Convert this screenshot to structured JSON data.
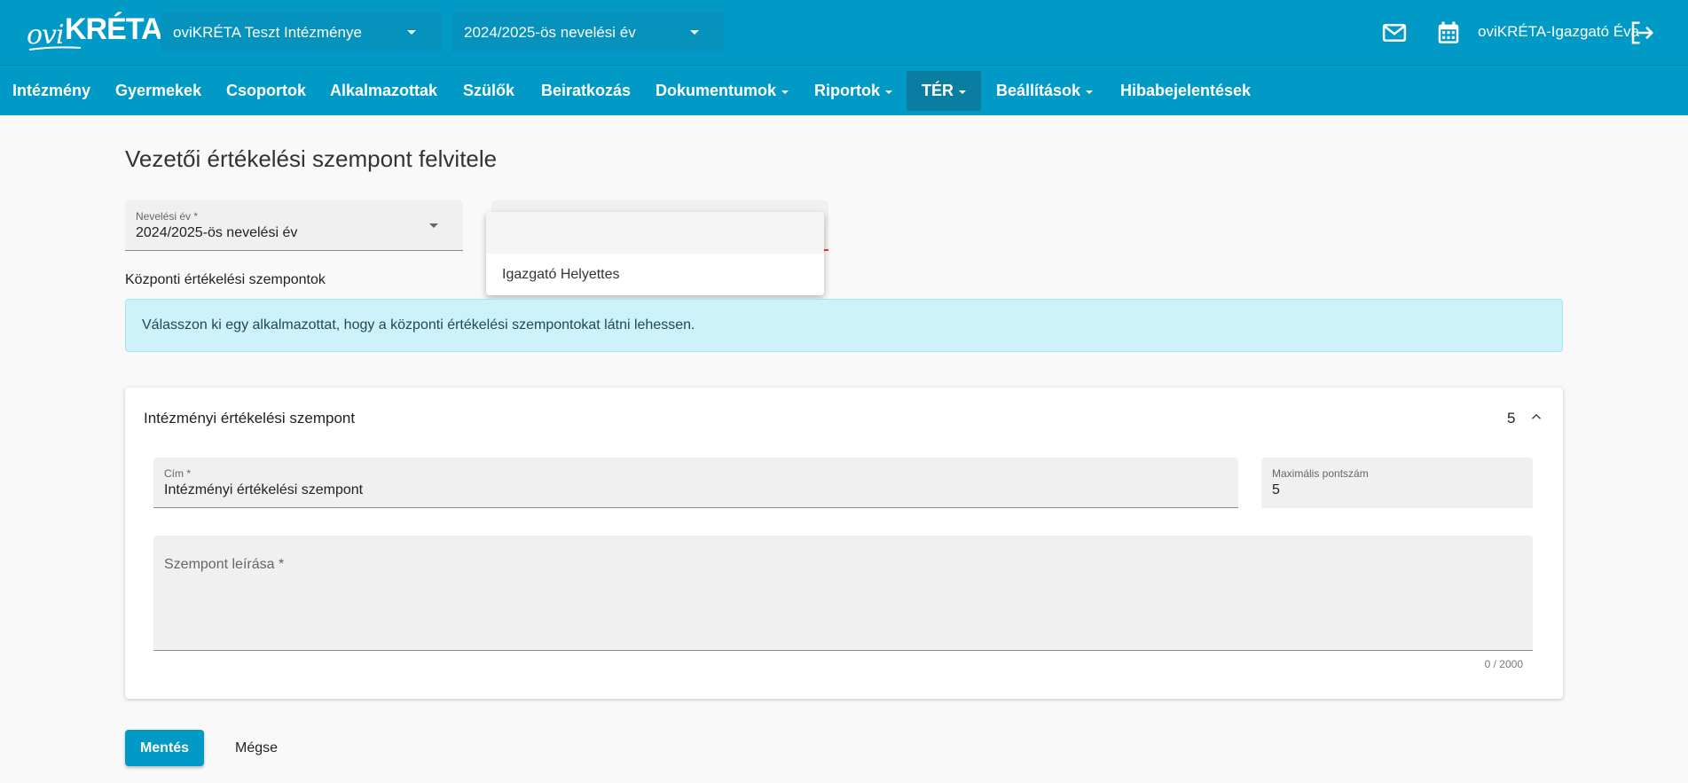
{
  "header": {
    "logo_text_ovi": "ovi",
    "logo_text_kreta": "KRÉTA",
    "institution": "oviKRÉTA Teszt Intézménye",
    "school_year": "2024/2025-ös nevelési év",
    "user_name": "oviKRÉTA-Igazgató Éva",
    "icons": [
      "mail-icon",
      "calendar-icon",
      "logout-icon"
    ]
  },
  "nav": {
    "items": [
      {
        "label": "Intézmény",
        "dropdown": false
      },
      {
        "label": "Gyermekek",
        "dropdown": false
      },
      {
        "label": "Csoportok",
        "dropdown": false
      },
      {
        "label": "Alkalmazottak",
        "dropdown": false
      },
      {
        "label": "Szülők",
        "dropdown": false
      },
      {
        "label": "Beiratkozás",
        "dropdown": false
      },
      {
        "label": "Dokumentumok",
        "dropdown": true
      },
      {
        "label": "Riportok",
        "dropdown": true
      },
      {
        "label": "TÉR",
        "dropdown": true,
        "active": true
      },
      {
        "label": "Beállítások",
        "dropdown": true
      },
      {
        "label": "Hibabejelentések",
        "dropdown": false
      }
    ]
  },
  "main": {
    "title": "Vezetői értékelési szempont felvitele",
    "year_field": {
      "label": "Nevelési év *",
      "value": "2024/2025-ös nevelési év"
    },
    "employee_dropdown": {
      "options": [
        "",
        "Igazgató Helyettes"
      ]
    },
    "central_section_label": "Központi értékelési szempontok",
    "info_message": "Válasszon ki egy alkalmazottat, hogy a központi értékelési szempontokat látni lehessen.",
    "card": {
      "title": "Intézményi értékelési szempont",
      "count": "5",
      "title_field": {
        "label": "Cím *",
        "value": "Intézményi értékelési szempont"
      },
      "max_points_field": {
        "label": "Maximális pontszám",
        "value": "5"
      },
      "description_field": {
        "placeholder": "Szempont leírása *",
        "counter": "0 / 2000"
      }
    },
    "actions": {
      "save_label": "Mentés",
      "cancel_label": "Mégse"
    }
  },
  "colors": {
    "brand": "#0199c6",
    "nav_active": "#0a7ea1",
    "info_bg": "#cdf2fa",
    "error": "#e53935"
  }
}
